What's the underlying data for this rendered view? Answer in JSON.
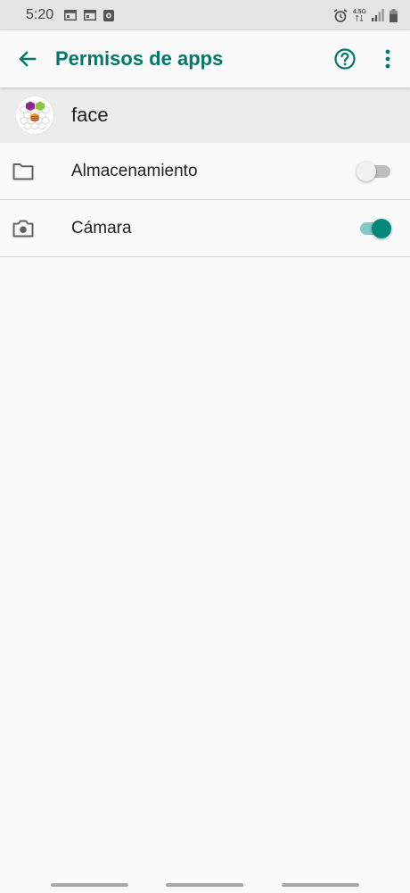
{
  "status_bar": {
    "time": "5:20",
    "network": "4.5G"
  },
  "app_bar": {
    "title": "Permisos de apps",
    "back_icon": "arrow-left-icon",
    "help_icon": "help-circle-icon",
    "more_icon": "more-vert-icon"
  },
  "app": {
    "name": "face"
  },
  "permissions": [
    {
      "label": "Almacenamiento",
      "icon": "folder-icon",
      "enabled": false
    },
    {
      "label": "Cámara",
      "icon": "camera-icon",
      "enabled": true
    }
  ],
  "colors": {
    "accent": "#00796b",
    "toggle_on_thumb": "#00897b",
    "toggle_on_track": "#80cbc4"
  }
}
